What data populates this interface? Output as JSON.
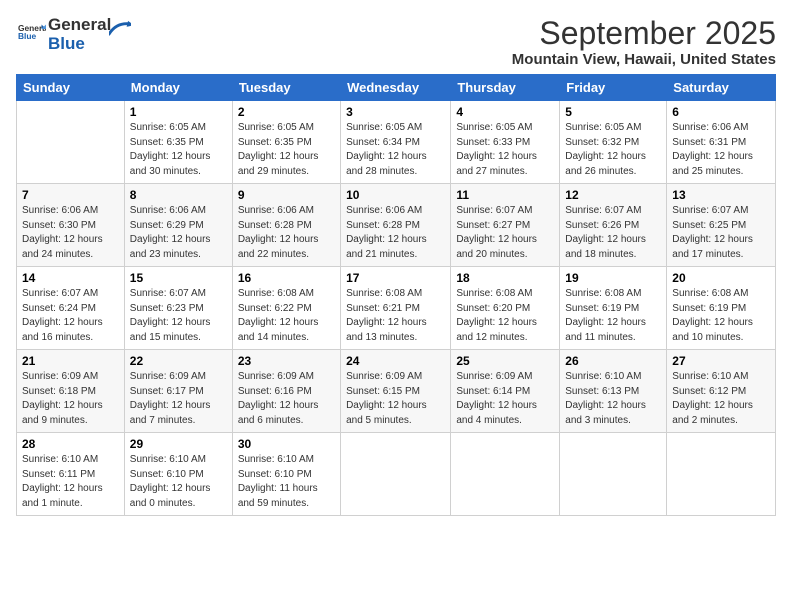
{
  "logo": {
    "line1": "General",
    "line2": "Blue"
  },
  "title": "September 2025",
  "location": "Mountain View, Hawaii, United States",
  "days_of_week": [
    "Sunday",
    "Monday",
    "Tuesday",
    "Wednesday",
    "Thursday",
    "Friday",
    "Saturday"
  ],
  "weeks": [
    [
      {
        "num": "",
        "info": ""
      },
      {
        "num": "1",
        "info": "Sunrise: 6:05 AM\nSunset: 6:35 PM\nDaylight: 12 hours\nand 30 minutes."
      },
      {
        "num": "2",
        "info": "Sunrise: 6:05 AM\nSunset: 6:35 PM\nDaylight: 12 hours\nand 29 minutes."
      },
      {
        "num": "3",
        "info": "Sunrise: 6:05 AM\nSunset: 6:34 PM\nDaylight: 12 hours\nand 28 minutes."
      },
      {
        "num": "4",
        "info": "Sunrise: 6:05 AM\nSunset: 6:33 PM\nDaylight: 12 hours\nand 27 minutes."
      },
      {
        "num": "5",
        "info": "Sunrise: 6:05 AM\nSunset: 6:32 PM\nDaylight: 12 hours\nand 26 minutes."
      },
      {
        "num": "6",
        "info": "Sunrise: 6:06 AM\nSunset: 6:31 PM\nDaylight: 12 hours\nand 25 minutes."
      }
    ],
    [
      {
        "num": "7",
        "info": "Sunrise: 6:06 AM\nSunset: 6:30 PM\nDaylight: 12 hours\nand 24 minutes."
      },
      {
        "num": "8",
        "info": "Sunrise: 6:06 AM\nSunset: 6:29 PM\nDaylight: 12 hours\nand 23 minutes."
      },
      {
        "num": "9",
        "info": "Sunrise: 6:06 AM\nSunset: 6:28 PM\nDaylight: 12 hours\nand 22 minutes."
      },
      {
        "num": "10",
        "info": "Sunrise: 6:06 AM\nSunset: 6:28 PM\nDaylight: 12 hours\nand 21 minutes."
      },
      {
        "num": "11",
        "info": "Sunrise: 6:07 AM\nSunset: 6:27 PM\nDaylight: 12 hours\nand 20 minutes."
      },
      {
        "num": "12",
        "info": "Sunrise: 6:07 AM\nSunset: 6:26 PM\nDaylight: 12 hours\nand 18 minutes."
      },
      {
        "num": "13",
        "info": "Sunrise: 6:07 AM\nSunset: 6:25 PM\nDaylight: 12 hours\nand 17 minutes."
      }
    ],
    [
      {
        "num": "14",
        "info": "Sunrise: 6:07 AM\nSunset: 6:24 PM\nDaylight: 12 hours\nand 16 minutes."
      },
      {
        "num": "15",
        "info": "Sunrise: 6:07 AM\nSunset: 6:23 PM\nDaylight: 12 hours\nand 15 minutes."
      },
      {
        "num": "16",
        "info": "Sunrise: 6:08 AM\nSunset: 6:22 PM\nDaylight: 12 hours\nand 14 minutes."
      },
      {
        "num": "17",
        "info": "Sunrise: 6:08 AM\nSunset: 6:21 PM\nDaylight: 12 hours\nand 13 minutes."
      },
      {
        "num": "18",
        "info": "Sunrise: 6:08 AM\nSunset: 6:20 PM\nDaylight: 12 hours\nand 12 minutes."
      },
      {
        "num": "19",
        "info": "Sunrise: 6:08 AM\nSunset: 6:19 PM\nDaylight: 12 hours\nand 11 minutes."
      },
      {
        "num": "20",
        "info": "Sunrise: 6:08 AM\nSunset: 6:19 PM\nDaylight: 12 hours\nand 10 minutes."
      }
    ],
    [
      {
        "num": "21",
        "info": "Sunrise: 6:09 AM\nSunset: 6:18 PM\nDaylight: 12 hours\nand 9 minutes."
      },
      {
        "num": "22",
        "info": "Sunrise: 6:09 AM\nSunset: 6:17 PM\nDaylight: 12 hours\nand 7 minutes."
      },
      {
        "num": "23",
        "info": "Sunrise: 6:09 AM\nSunset: 6:16 PM\nDaylight: 12 hours\nand 6 minutes."
      },
      {
        "num": "24",
        "info": "Sunrise: 6:09 AM\nSunset: 6:15 PM\nDaylight: 12 hours\nand 5 minutes."
      },
      {
        "num": "25",
        "info": "Sunrise: 6:09 AM\nSunset: 6:14 PM\nDaylight: 12 hours\nand 4 minutes."
      },
      {
        "num": "26",
        "info": "Sunrise: 6:10 AM\nSunset: 6:13 PM\nDaylight: 12 hours\nand 3 minutes."
      },
      {
        "num": "27",
        "info": "Sunrise: 6:10 AM\nSunset: 6:12 PM\nDaylight: 12 hours\nand 2 minutes."
      }
    ],
    [
      {
        "num": "28",
        "info": "Sunrise: 6:10 AM\nSunset: 6:11 PM\nDaylight: 12 hours\nand 1 minute."
      },
      {
        "num": "29",
        "info": "Sunrise: 6:10 AM\nSunset: 6:10 PM\nDaylight: 12 hours\nand 0 minutes."
      },
      {
        "num": "30",
        "info": "Sunrise: 6:10 AM\nSunset: 6:10 PM\nDaylight: 11 hours\nand 59 minutes."
      },
      {
        "num": "",
        "info": ""
      },
      {
        "num": "",
        "info": ""
      },
      {
        "num": "",
        "info": ""
      },
      {
        "num": "",
        "info": ""
      }
    ]
  ]
}
